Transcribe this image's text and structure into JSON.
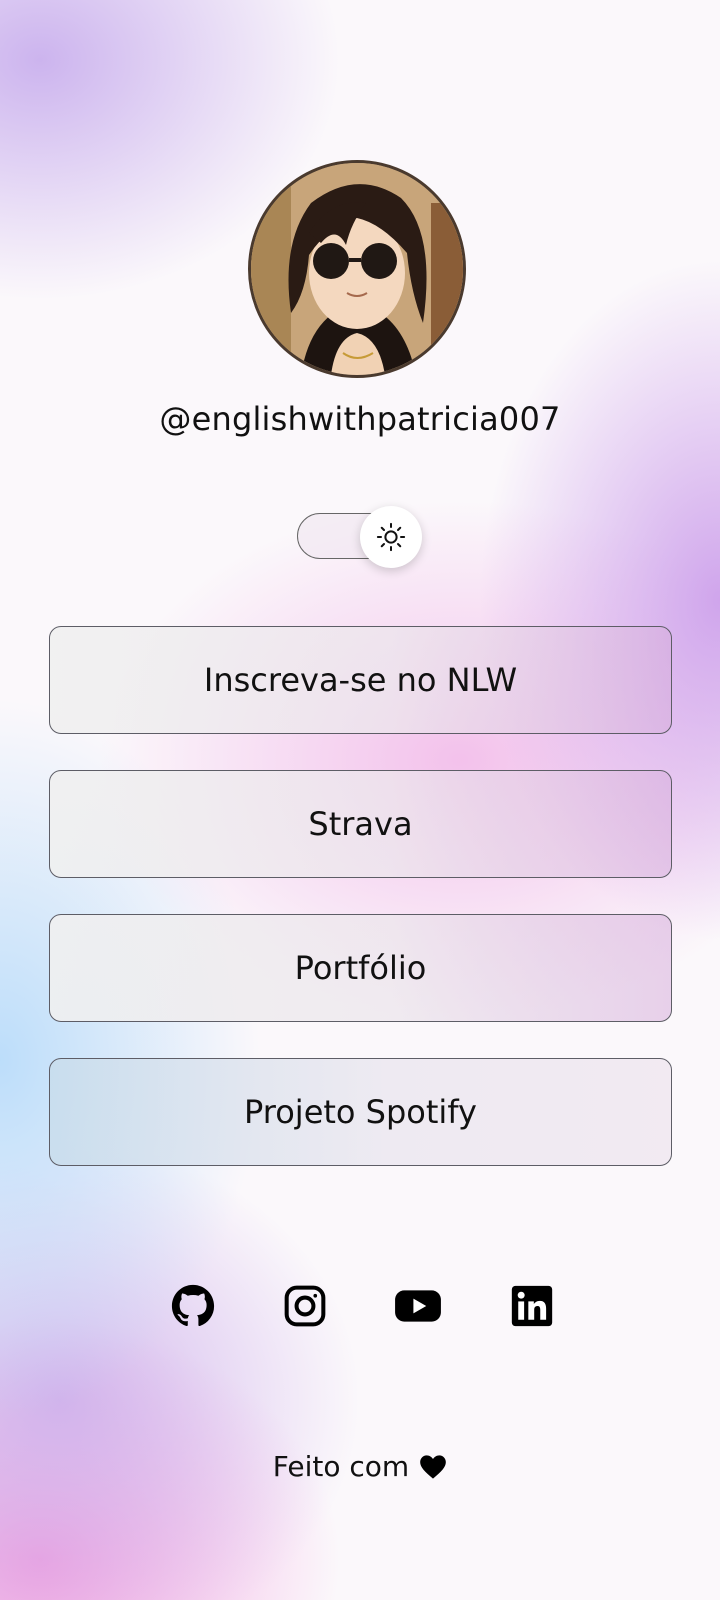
{
  "profile": {
    "username": "@englishwithpatricia007",
    "avatar_alt": "avatar"
  },
  "theme_toggle": {
    "icon": "sun-icon",
    "state": "light"
  },
  "links": [
    {
      "label": "Inscreva-se no NLW"
    },
    {
      "label": "Strava"
    },
    {
      "label": "Portfólio"
    },
    {
      "label": "Projeto Spotify"
    }
  ],
  "social": [
    {
      "icon": "github-icon"
    },
    {
      "icon": "instagram-icon"
    },
    {
      "icon": "youtube-icon"
    },
    {
      "icon": "linkedin-icon"
    }
  ],
  "footer": {
    "text": "Feito com",
    "icon": "heart-icon"
  }
}
